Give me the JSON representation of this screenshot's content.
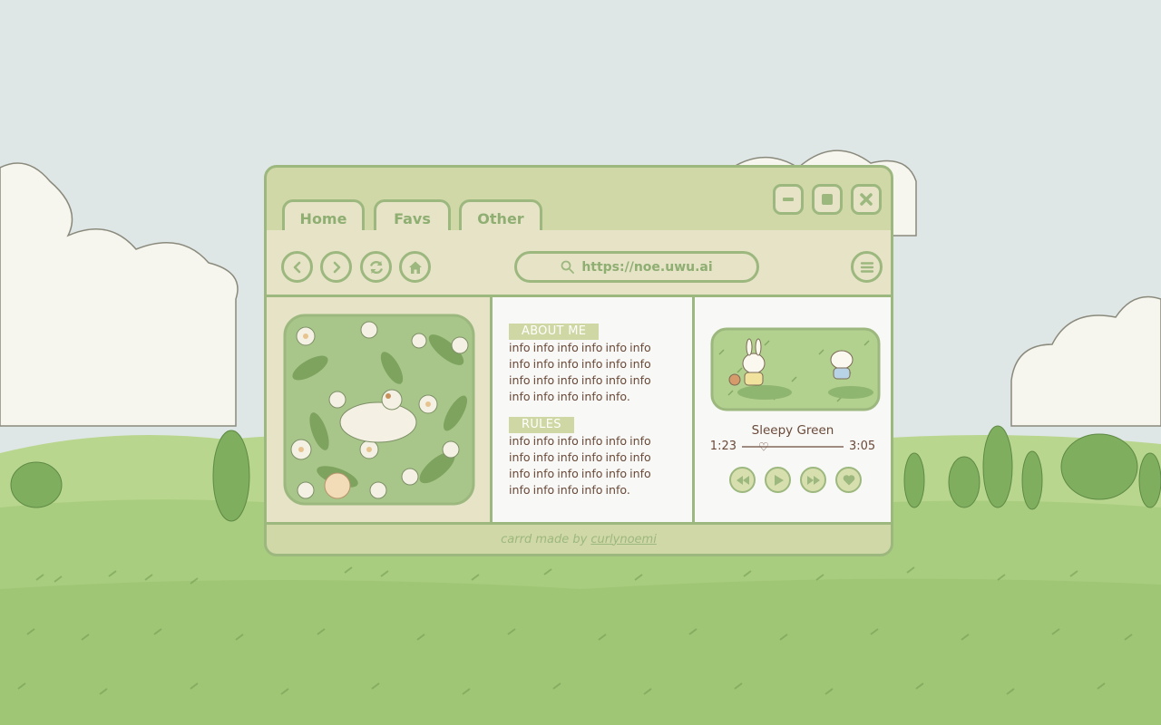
{
  "tabs": [
    {
      "label": "Home"
    },
    {
      "label": "Favs"
    },
    {
      "label": "Other"
    }
  ],
  "window_controls": [
    "minimize-icon",
    "maximize-icon",
    "close-icon"
  ],
  "toolbar": {
    "nav_icons": [
      "back-icon",
      "forward-icon",
      "refresh-icon",
      "home-icon"
    ],
    "url": "https://noe.uwu.ai",
    "menu_icon": "hamburger-menu-icon"
  },
  "about": {
    "title": "ABOUT ME",
    "text": "info info info info info info info info info info info info info info info info info info info info info info info."
  },
  "rules": {
    "title": "RULES",
    "text": "info info info info info info info info info info info info info info info info info info info info info info info."
  },
  "player": {
    "song": "Sleepy Green",
    "current_time": "1:23",
    "total_time": "3:05",
    "progress": 0.18,
    "controls": [
      "rewind-icon",
      "play-icon",
      "fast-forward-icon",
      "heart-icon"
    ]
  },
  "footer": {
    "prefix": "carrd made by",
    "author": "curlynoemi"
  },
  "colors": {
    "window_bg": "#d1d8a8",
    "border": "#9cb87e",
    "panel_cream": "#e6e3c7",
    "panel_white": "#f8f8f6",
    "text_brown": "#6a4a39",
    "sky": "#dfe6e6",
    "grass": "#a9cd7f"
  }
}
